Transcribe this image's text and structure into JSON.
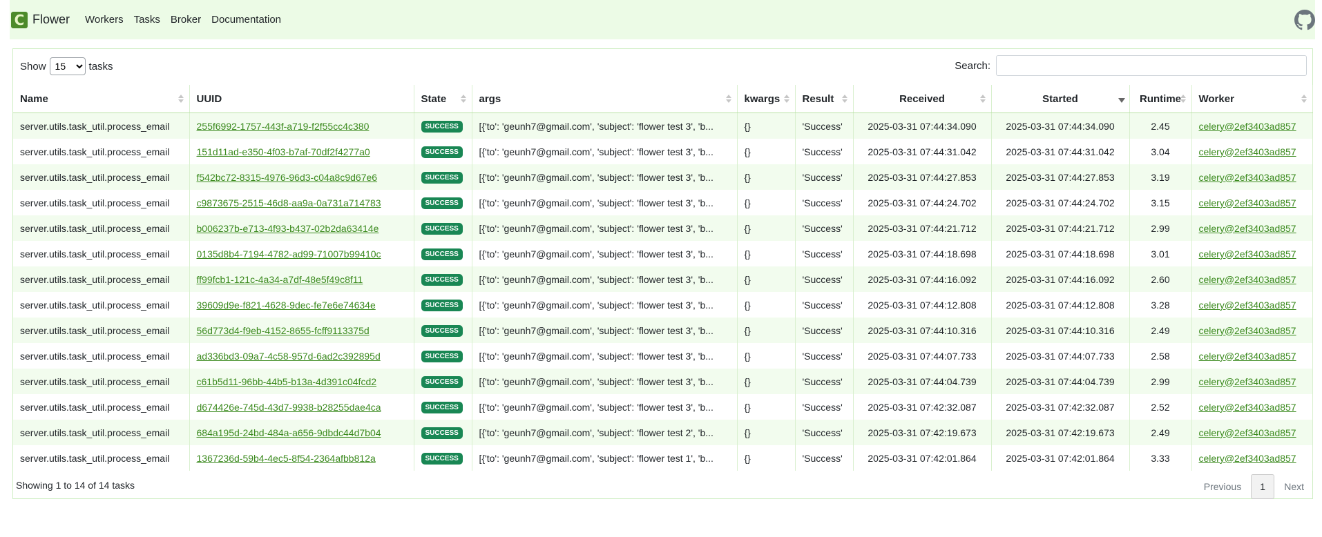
{
  "nav": {
    "brand": "Flower",
    "links": [
      "Workers",
      "Tasks",
      "Broker",
      "Documentation"
    ],
    "github_icon": "github-icon"
  },
  "controls": {
    "show_prefix": "Show",
    "show_value": "15",
    "show_suffix": "tasks",
    "search_label": "Search:"
  },
  "table": {
    "columns": [
      "Name",
      "UUID",
      "State",
      "args",
      "kwargs",
      "Result",
      "Received",
      "Started",
      "Runtime",
      "Worker"
    ],
    "sorted_column": "Started",
    "rows": [
      {
        "name": "server.utils.task_util.process_email",
        "uuid": "255f6992-1757-443f-a719-f2f55cc4c380",
        "state": "SUCCESS",
        "args": "[{'to': 'geunh7@gmail.com', 'subject': 'flower test 3', 'b...",
        "kwargs": "{}",
        "result": "'Success'",
        "received": "2025-03-31 07:44:34.090",
        "started": "2025-03-31 07:44:34.090",
        "runtime": "2.45",
        "worker": "celery@2ef3403ad857"
      },
      {
        "name": "server.utils.task_util.process_email",
        "uuid": "151d11ad-e350-4f03-b7af-70df2f4277a0",
        "state": "SUCCESS",
        "args": "[{'to': 'geunh7@gmail.com', 'subject': 'flower test 3', 'b...",
        "kwargs": "{}",
        "result": "'Success'",
        "received": "2025-03-31 07:44:31.042",
        "started": "2025-03-31 07:44:31.042",
        "runtime": "3.04",
        "worker": "celery@2ef3403ad857"
      },
      {
        "name": "server.utils.task_util.process_email",
        "uuid": "f542bc72-8315-4976-96d3-c04a8c9d67e6",
        "state": "SUCCESS",
        "args": "[{'to': 'geunh7@gmail.com', 'subject': 'flower test 3', 'b...",
        "kwargs": "{}",
        "result": "'Success'",
        "received": "2025-03-31 07:44:27.853",
        "started": "2025-03-31 07:44:27.853",
        "runtime": "3.19",
        "worker": "celery@2ef3403ad857"
      },
      {
        "name": "server.utils.task_util.process_email",
        "uuid": "c9873675-2515-46d8-aa9a-0a731a714783",
        "state": "SUCCESS",
        "args": "[{'to': 'geunh7@gmail.com', 'subject': 'flower test 3', 'b...",
        "kwargs": "{}",
        "result": "'Success'",
        "received": "2025-03-31 07:44:24.702",
        "started": "2025-03-31 07:44:24.702",
        "runtime": "3.15",
        "worker": "celery@2ef3403ad857"
      },
      {
        "name": "server.utils.task_util.process_email",
        "uuid": "b006237b-e713-4f93-b437-02b2da63414e",
        "state": "SUCCESS",
        "args": "[{'to': 'geunh7@gmail.com', 'subject': 'flower test 3', 'b...",
        "kwargs": "{}",
        "result": "'Success'",
        "received": "2025-03-31 07:44:21.712",
        "started": "2025-03-31 07:44:21.712",
        "runtime": "2.99",
        "worker": "celery@2ef3403ad857"
      },
      {
        "name": "server.utils.task_util.process_email",
        "uuid": "0135d8b4-7194-4782-ad99-71007b99410c",
        "state": "SUCCESS",
        "args": "[{'to': 'geunh7@gmail.com', 'subject': 'flower test 3', 'b...",
        "kwargs": "{}",
        "result": "'Success'",
        "received": "2025-03-31 07:44:18.698",
        "started": "2025-03-31 07:44:18.698",
        "runtime": "3.01",
        "worker": "celery@2ef3403ad857"
      },
      {
        "name": "server.utils.task_util.process_email",
        "uuid": "ff99fcb1-121c-4a34-a7df-48e5f49c8f11",
        "state": "SUCCESS",
        "args": "[{'to': 'geunh7@gmail.com', 'subject': 'flower test 3', 'b...",
        "kwargs": "{}",
        "result": "'Success'",
        "received": "2025-03-31 07:44:16.092",
        "started": "2025-03-31 07:44:16.092",
        "runtime": "2.60",
        "worker": "celery@2ef3403ad857"
      },
      {
        "name": "server.utils.task_util.process_email",
        "uuid": "39609d9e-f821-4628-9dec-fe7e6e74634e",
        "state": "SUCCESS",
        "args": "[{'to': 'geunh7@gmail.com', 'subject': 'flower test 3', 'b...",
        "kwargs": "{}",
        "result": "'Success'",
        "received": "2025-03-31 07:44:12.808",
        "started": "2025-03-31 07:44:12.808",
        "runtime": "3.28",
        "worker": "celery@2ef3403ad857"
      },
      {
        "name": "server.utils.task_util.process_email",
        "uuid": "56d773d4-f9eb-4152-8655-fcff9113375d",
        "state": "SUCCESS",
        "args": "[{'to': 'geunh7@gmail.com', 'subject': 'flower test 3', 'b...",
        "kwargs": "{}",
        "result": "'Success'",
        "received": "2025-03-31 07:44:10.316",
        "started": "2025-03-31 07:44:10.316",
        "runtime": "2.49",
        "worker": "celery@2ef3403ad857"
      },
      {
        "name": "server.utils.task_util.process_email",
        "uuid": "ad336bd3-09a7-4c58-957d-6ad2c392895d",
        "state": "SUCCESS",
        "args": "[{'to': 'geunh7@gmail.com', 'subject': 'flower test 3', 'b...",
        "kwargs": "{}",
        "result": "'Success'",
        "received": "2025-03-31 07:44:07.733",
        "started": "2025-03-31 07:44:07.733",
        "runtime": "2.58",
        "worker": "celery@2ef3403ad857"
      },
      {
        "name": "server.utils.task_util.process_email",
        "uuid": "c61b5d11-96bb-44b5-b13a-4d391c04fcd2",
        "state": "SUCCESS",
        "args": "[{'to': 'geunh7@gmail.com', 'subject': 'flower test 3', 'b...",
        "kwargs": "{}",
        "result": "'Success'",
        "received": "2025-03-31 07:44:04.739",
        "started": "2025-03-31 07:44:04.739",
        "runtime": "2.99",
        "worker": "celery@2ef3403ad857"
      },
      {
        "name": "server.utils.task_util.process_email",
        "uuid": "d674426e-745d-43d7-9938-b28255dae4ca",
        "state": "SUCCESS",
        "args": "[{'to': 'geunh7@gmail.com', 'subject': 'flower test 3', 'b...",
        "kwargs": "{}",
        "result": "'Success'",
        "received": "2025-03-31 07:42:32.087",
        "started": "2025-03-31 07:42:32.087",
        "runtime": "2.52",
        "worker": "celery@2ef3403ad857"
      },
      {
        "name": "server.utils.task_util.process_email",
        "uuid": "684a195d-24bd-484a-a656-9dbdc44d7b04",
        "state": "SUCCESS",
        "args": "[{'to': 'geunh7@gmail.com', 'subject': 'flower test 2', 'b...",
        "kwargs": "{}",
        "result": "'Success'",
        "received": "2025-03-31 07:42:19.673",
        "started": "2025-03-31 07:42:19.673",
        "runtime": "2.49",
        "worker": "celery@2ef3403ad857"
      },
      {
        "name": "server.utils.task_util.process_email",
        "uuid": "1367236d-59b4-4ec5-8f54-2364afbb812a",
        "state": "SUCCESS",
        "args": "[{'to': 'geunh7@gmail.com', 'subject': 'flower test 1', 'b...",
        "kwargs": "{}",
        "result": "'Success'",
        "received": "2025-03-31 07:42:01.864",
        "started": "2025-03-31 07:42:01.864",
        "runtime": "3.33",
        "worker": "celery@2ef3403ad857"
      }
    ]
  },
  "footer": {
    "info": "Showing 1 to 14 of 14 tasks",
    "previous": "Previous",
    "page": "1",
    "next": "Next"
  },
  "colors": {
    "accent": "#3b8a1e",
    "navbar_bg": "#ecfbe6",
    "success_badge": "#198754",
    "row_stripe": "#f2fcee"
  }
}
